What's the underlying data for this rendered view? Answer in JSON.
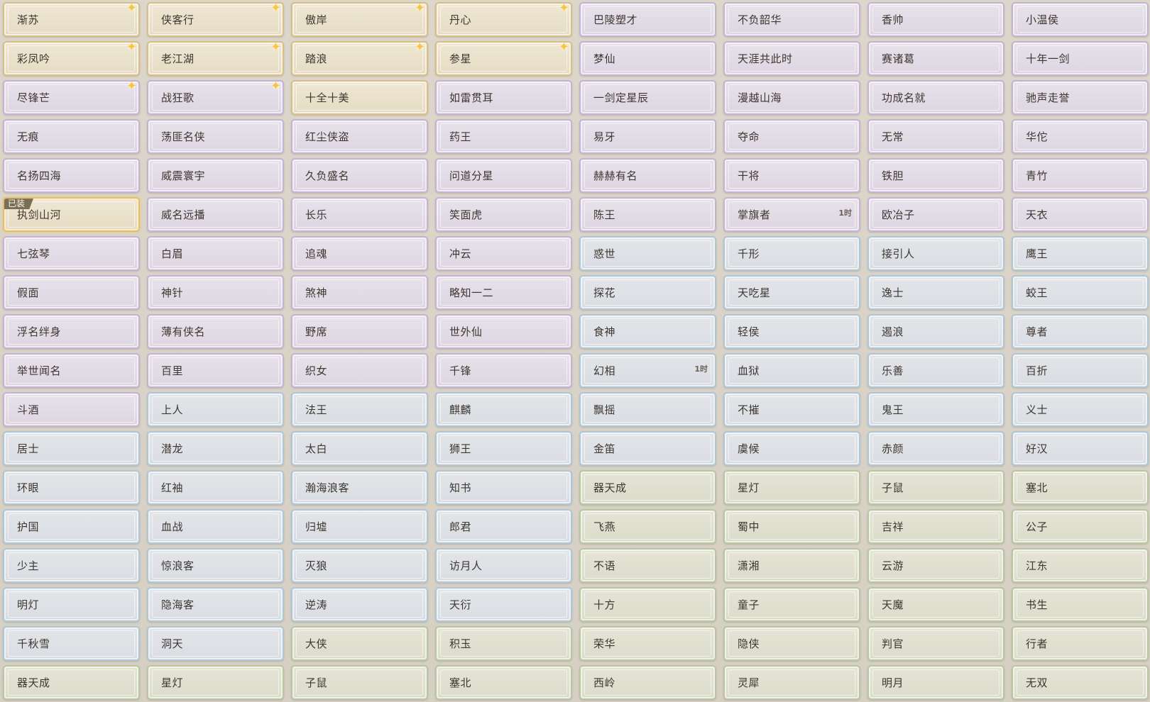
{
  "colors": {
    "gold": "#d9bf86",
    "purple": "#c3b4d3",
    "blue": "#aec7d8",
    "green": "#b8c79f",
    "star": "#f6c548",
    "equipped_tag": "#7b6e57"
  },
  "icons": {
    "corner_star": "sparkle-star-icon"
  },
  "equipped_label": "已装",
  "titles": [
    {
      "name": "渐苏",
      "rarity": "gold",
      "star": true
    },
    {
      "name": "侠客行",
      "rarity": "gold",
      "star": true
    },
    {
      "name": "傲岸",
      "rarity": "gold",
      "star": true
    },
    {
      "name": "丹心",
      "rarity": "gold",
      "star": true
    },
    {
      "name": "巴陵塑才",
      "rarity": "purple"
    },
    {
      "name": "不负韶华",
      "rarity": "purple"
    },
    {
      "name": "香帅",
      "rarity": "purple"
    },
    {
      "name": "小温侯",
      "rarity": "purple"
    },
    {
      "name": "彩凤吟",
      "rarity": "gold",
      "star": true
    },
    {
      "name": "老江湖",
      "rarity": "gold",
      "star": true
    },
    {
      "name": "踏浪",
      "rarity": "gold",
      "star": true
    },
    {
      "name": "参星",
      "rarity": "gold",
      "star": true
    },
    {
      "name": "梦仙",
      "rarity": "purple"
    },
    {
      "name": "天涯共此时",
      "rarity": "purple"
    },
    {
      "name": "赛诸葛",
      "rarity": "purple"
    },
    {
      "name": "十年一剑",
      "rarity": "purple"
    },
    {
      "name": "尽锋芒",
      "rarity": "purple",
      "star": true
    },
    {
      "name": "战狂歌",
      "rarity": "purple",
      "star": true
    },
    {
      "name": "十全十美",
      "rarity": "gold"
    },
    {
      "name": "如雷贯耳",
      "rarity": "purple"
    },
    {
      "name": "一剑定星辰",
      "rarity": "purple"
    },
    {
      "name": "漫越山海",
      "rarity": "purple"
    },
    {
      "name": "功成名就",
      "rarity": "purple"
    },
    {
      "name": "驰声走誉",
      "rarity": "purple"
    },
    {
      "name": "无痕",
      "rarity": "purple"
    },
    {
      "name": "荡匪名侠",
      "rarity": "purple"
    },
    {
      "name": "红尘侠盗",
      "rarity": "purple"
    },
    {
      "name": "药王",
      "rarity": "purple"
    },
    {
      "name": "易牙",
      "rarity": "purple"
    },
    {
      "name": "夺命",
      "rarity": "purple"
    },
    {
      "name": "无常",
      "rarity": "purple"
    },
    {
      "name": "华佗",
      "rarity": "purple"
    },
    {
      "name": "名扬四海",
      "rarity": "purple"
    },
    {
      "name": "威震寰宇",
      "rarity": "purple"
    },
    {
      "name": "久负盛名",
      "rarity": "purple"
    },
    {
      "name": "问道分星",
      "rarity": "purple"
    },
    {
      "name": "赫赫有名",
      "rarity": "purple"
    },
    {
      "name": "干将",
      "rarity": "purple"
    },
    {
      "name": "铁胆",
      "rarity": "purple"
    },
    {
      "name": "青竹",
      "rarity": "purple"
    },
    {
      "name": "执剑山河",
      "rarity": "gold",
      "equipped": true
    },
    {
      "name": "威名远播",
      "rarity": "purple"
    },
    {
      "name": "长乐",
      "rarity": "purple"
    },
    {
      "name": "笑面虎",
      "rarity": "purple"
    },
    {
      "name": "陈王",
      "rarity": "purple"
    },
    {
      "name": "掌旗者",
      "rarity": "purple",
      "timer": "1时"
    },
    {
      "name": "欧冶子",
      "rarity": "purple"
    },
    {
      "name": "天衣",
      "rarity": "purple"
    },
    {
      "name": "七弦琴",
      "rarity": "purple"
    },
    {
      "name": "白眉",
      "rarity": "purple"
    },
    {
      "name": "追魂",
      "rarity": "purple"
    },
    {
      "name": "冲云",
      "rarity": "purple"
    },
    {
      "name": "惑世",
      "rarity": "blue"
    },
    {
      "name": "千形",
      "rarity": "blue"
    },
    {
      "name": "接引人",
      "rarity": "blue"
    },
    {
      "name": "鹰王",
      "rarity": "blue"
    },
    {
      "name": "假面",
      "rarity": "purple"
    },
    {
      "name": "神针",
      "rarity": "purple"
    },
    {
      "name": "煞神",
      "rarity": "purple"
    },
    {
      "name": "略知一二",
      "rarity": "purple"
    },
    {
      "name": "探花",
      "rarity": "blue"
    },
    {
      "name": "天吃星",
      "rarity": "blue"
    },
    {
      "name": "逸士",
      "rarity": "blue"
    },
    {
      "name": "蛟王",
      "rarity": "blue"
    },
    {
      "name": "浮名绊身",
      "rarity": "purple"
    },
    {
      "name": "薄有侠名",
      "rarity": "purple"
    },
    {
      "name": "野席",
      "rarity": "purple"
    },
    {
      "name": "世外仙",
      "rarity": "purple"
    },
    {
      "name": "食神",
      "rarity": "blue"
    },
    {
      "name": "轻侯",
      "rarity": "blue"
    },
    {
      "name": "遏浪",
      "rarity": "blue"
    },
    {
      "name": "尊者",
      "rarity": "blue"
    },
    {
      "name": "举世闻名",
      "rarity": "purple"
    },
    {
      "name": "百里",
      "rarity": "purple"
    },
    {
      "name": "织女",
      "rarity": "purple"
    },
    {
      "name": "千锋",
      "rarity": "purple"
    },
    {
      "name": "幻相",
      "rarity": "blue",
      "timer": "1时"
    },
    {
      "name": "血狱",
      "rarity": "blue"
    },
    {
      "name": "乐善",
      "rarity": "blue"
    },
    {
      "name": "百折",
      "rarity": "blue"
    },
    {
      "name": "斗酒",
      "rarity": "purple"
    },
    {
      "name": "上人",
      "rarity": "blue"
    },
    {
      "name": "法王",
      "rarity": "blue"
    },
    {
      "name": "麒麟",
      "rarity": "blue"
    },
    {
      "name": "飘摇",
      "rarity": "blue"
    },
    {
      "name": "不摧",
      "rarity": "blue"
    },
    {
      "name": "鬼王",
      "rarity": "blue"
    },
    {
      "name": "义士",
      "rarity": "blue"
    },
    {
      "name": "居士",
      "rarity": "blue"
    },
    {
      "name": "潜龙",
      "rarity": "blue"
    },
    {
      "name": "太白",
      "rarity": "blue"
    },
    {
      "name": "狮王",
      "rarity": "blue"
    },
    {
      "name": "金笛",
      "rarity": "blue"
    },
    {
      "name": "虞候",
      "rarity": "blue"
    },
    {
      "name": "赤颜",
      "rarity": "blue"
    },
    {
      "name": "好汉",
      "rarity": "blue"
    },
    {
      "name": "环眼",
      "rarity": "blue"
    },
    {
      "name": "红袖",
      "rarity": "blue"
    },
    {
      "name": "瀚海浪客",
      "rarity": "blue"
    },
    {
      "name": "知书",
      "rarity": "blue"
    },
    {
      "name": "器天成",
      "rarity": "green"
    },
    {
      "name": "星灯",
      "rarity": "green"
    },
    {
      "name": "子鼠",
      "rarity": "green"
    },
    {
      "name": "塞北",
      "rarity": "green"
    },
    {
      "name": "护国",
      "rarity": "blue"
    },
    {
      "name": "血战",
      "rarity": "blue"
    },
    {
      "name": "归墟",
      "rarity": "blue"
    },
    {
      "name": "郎君",
      "rarity": "blue"
    },
    {
      "name": "飞燕",
      "rarity": "green"
    },
    {
      "name": "蜀中",
      "rarity": "green"
    },
    {
      "name": "吉祥",
      "rarity": "green"
    },
    {
      "name": "公子",
      "rarity": "green"
    },
    {
      "name": "少主",
      "rarity": "blue"
    },
    {
      "name": "惊浪客",
      "rarity": "blue"
    },
    {
      "name": "灭狼",
      "rarity": "blue"
    },
    {
      "name": "访月人",
      "rarity": "blue"
    },
    {
      "name": "不语",
      "rarity": "green"
    },
    {
      "name": "潇湘",
      "rarity": "green"
    },
    {
      "name": "云游",
      "rarity": "green"
    },
    {
      "name": "江东",
      "rarity": "green"
    },
    {
      "name": "明灯",
      "rarity": "blue"
    },
    {
      "name": "隐海客",
      "rarity": "blue"
    },
    {
      "name": "逆涛",
      "rarity": "blue"
    },
    {
      "name": "天衍",
      "rarity": "blue"
    },
    {
      "name": "十方",
      "rarity": "green"
    },
    {
      "name": "童子",
      "rarity": "green"
    },
    {
      "name": "天魔",
      "rarity": "green"
    },
    {
      "name": "书生",
      "rarity": "green"
    },
    {
      "name": "千秋雪",
      "rarity": "blue"
    },
    {
      "name": "洞天",
      "rarity": "blue"
    },
    {
      "name": "大侠",
      "rarity": "green"
    },
    {
      "name": "积玉",
      "rarity": "green"
    },
    {
      "name": "荣华",
      "rarity": "green"
    },
    {
      "name": "隐侠",
      "rarity": "green"
    },
    {
      "name": "判官",
      "rarity": "green"
    },
    {
      "name": "行者",
      "rarity": "green"
    },
    {
      "name": "器天成",
      "rarity": "green"
    },
    {
      "name": "星灯",
      "rarity": "green"
    },
    {
      "name": "子鼠",
      "rarity": "green"
    },
    {
      "name": "塞北",
      "rarity": "green"
    },
    {
      "name": "西岭",
      "rarity": "green"
    },
    {
      "name": "灵犀",
      "rarity": "green"
    },
    {
      "name": "明月",
      "rarity": "green"
    },
    {
      "name": "无双",
      "rarity": "green"
    }
  ]
}
